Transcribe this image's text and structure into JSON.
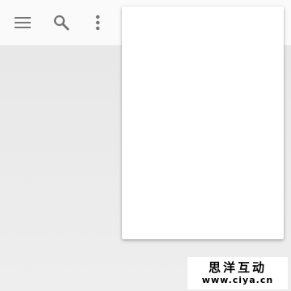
{
  "toolbar": {
    "menu_icon": "hamburger-menu-icon",
    "search_icon": "search-icon",
    "overflow_icon": "more-vert-icon",
    "background": "#fafafa",
    "icon_color": "#757575"
  },
  "overflow_menu": {
    "open": true,
    "items": [],
    "background": "#ffffff"
  },
  "page": {
    "background": "#ebebeb"
  },
  "watermark": {
    "title": "思洋互动",
    "url": "www.ciya.cn"
  }
}
